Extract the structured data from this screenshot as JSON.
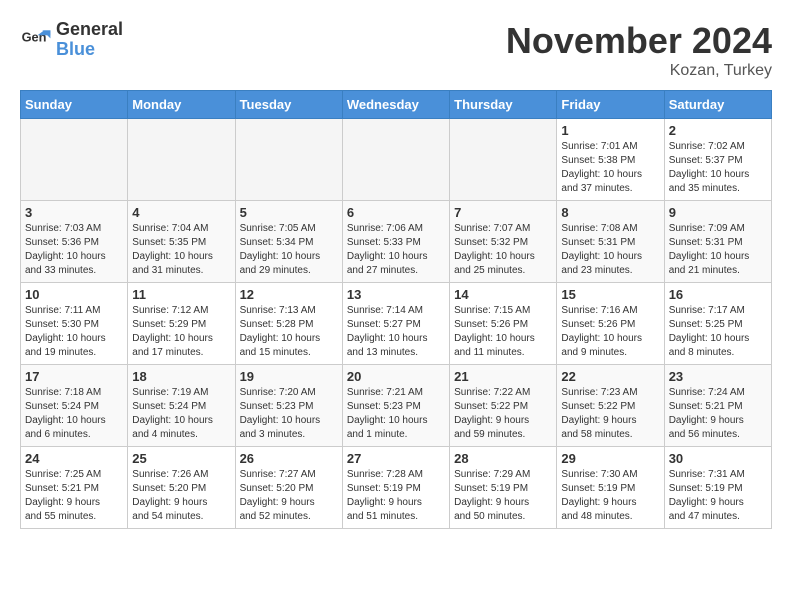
{
  "logo": {
    "general": "General",
    "blue": "Blue"
  },
  "title": "November 2024",
  "subtitle": "Kozan, Turkey",
  "days_of_week": [
    "Sunday",
    "Monday",
    "Tuesday",
    "Wednesday",
    "Thursday",
    "Friday",
    "Saturday"
  ],
  "weeks": [
    [
      {
        "day": "",
        "info": ""
      },
      {
        "day": "",
        "info": ""
      },
      {
        "day": "",
        "info": ""
      },
      {
        "day": "",
        "info": ""
      },
      {
        "day": "",
        "info": ""
      },
      {
        "day": "1",
        "info": "Sunrise: 7:01 AM\nSunset: 5:38 PM\nDaylight: 10 hours\nand 37 minutes."
      },
      {
        "day": "2",
        "info": "Sunrise: 7:02 AM\nSunset: 5:37 PM\nDaylight: 10 hours\nand 35 minutes."
      }
    ],
    [
      {
        "day": "3",
        "info": "Sunrise: 7:03 AM\nSunset: 5:36 PM\nDaylight: 10 hours\nand 33 minutes."
      },
      {
        "day": "4",
        "info": "Sunrise: 7:04 AM\nSunset: 5:35 PM\nDaylight: 10 hours\nand 31 minutes."
      },
      {
        "day": "5",
        "info": "Sunrise: 7:05 AM\nSunset: 5:34 PM\nDaylight: 10 hours\nand 29 minutes."
      },
      {
        "day": "6",
        "info": "Sunrise: 7:06 AM\nSunset: 5:33 PM\nDaylight: 10 hours\nand 27 minutes."
      },
      {
        "day": "7",
        "info": "Sunrise: 7:07 AM\nSunset: 5:32 PM\nDaylight: 10 hours\nand 25 minutes."
      },
      {
        "day": "8",
        "info": "Sunrise: 7:08 AM\nSunset: 5:31 PM\nDaylight: 10 hours\nand 23 minutes."
      },
      {
        "day": "9",
        "info": "Sunrise: 7:09 AM\nSunset: 5:31 PM\nDaylight: 10 hours\nand 21 minutes."
      }
    ],
    [
      {
        "day": "10",
        "info": "Sunrise: 7:11 AM\nSunset: 5:30 PM\nDaylight: 10 hours\nand 19 minutes."
      },
      {
        "day": "11",
        "info": "Sunrise: 7:12 AM\nSunset: 5:29 PM\nDaylight: 10 hours\nand 17 minutes."
      },
      {
        "day": "12",
        "info": "Sunrise: 7:13 AM\nSunset: 5:28 PM\nDaylight: 10 hours\nand 15 minutes."
      },
      {
        "day": "13",
        "info": "Sunrise: 7:14 AM\nSunset: 5:27 PM\nDaylight: 10 hours\nand 13 minutes."
      },
      {
        "day": "14",
        "info": "Sunrise: 7:15 AM\nSunset: 5:26 PM\nDaylight: 10 hours\nand 11 minutes."
      },
      {
        "day": "15",
        "info": "Sunrise: 7:16 AM\nSunset: 5:26 PM\nDaylight: 10 hours\nand 9 minutes."
      },
      {
        "day": "16",
        "info": "Sunrise: 7:17 AM\nSunset: 5:25 PM\nDaylight: 10 hours\nand 8 minutes."
      }
    ],
    [
      {
        "day": "17",
        "info": "Sunrise: 7:18 AM\nSunset: 5:24 PM\nDaylight: 10 hours\nand 6 minutes."
      },
      {
        "day": "18",
        "info": "Sunrise: 7:19 AM\nSunset: 5:24 PM\nDaylight: 10 hours\nand 4 minutes."
      },
      {
        "day": "19",
        "info": "Sunrise: 7:20 AM\nSunset: 5:23 PM\nDaylight: 10 hours\nand 3 minutes."
      },
      {
        "day": "20",
        "info": "Sunrise: 7:21 AM\nSunset: 5:23 PM\nDaylight: 10 hours\nand 1 minute."
      },
      {
        "day": "21",
        "info": "Sunrise: 7:22 AM\nSunset: 5:22 PM\nDaylight: 9 hours\nand 59 minutes."
      },
      {
        "day": "22",
        "info": "Sunrise: 7:23 AM\nSunset: 5:22 PM\nDaylight: 9 hours\nand 58 minutes."
      },
      {
        "day": "23",
        "info": "Sunrise: 7:24 AM\nSunset: 5:21 PM\nDaylight: 9 hours\nand 56 minutes."
      }
    ],
    [
      {
        "day": "24",
        "info": "Sunrise: 7:25 AM\nSunset: 5:21 PM\nDaylight: 9 hours\nand 55 minutes."
      },
      {
        "day": "25",
        "info": "Sunrise: 7:26 AM\nSunset: 5:20 PM\nDaylight: 9 hours\nand 54 minutes."
      },
      {
        "day": "26",
        "info": "Sunrise: 7:27 AM\nSunset: 5:20 PM\nDaylight: 9 hours\nand 52 minutes."
      },
      {
        "day": "27",
        "info": "Sunrise: 7:28 AM\nSunset: 5:19 PM\nDaylight: 9 hours\nand 51 minutes."
      },
      {
        "day": "28",
        "info": "Sunrise: 7:29 AM\nSunset: 5:19 PM\nDaylight: 9 hours\nand 50 minutes."
      },
      {
        "day": "29",
        "info": "Sunrise: 7:30 AM\nSunset: 5:19 PM\nDaylight: 9 hours\nand 48 minutes."
      },
      {
        "day": "30",
        "info": "Sunrise: 7:31 AM\nSunset: 5:19 PM\nDaylight: 9 hours\nand 47 minutes."
      }
    ]
  ]
}
